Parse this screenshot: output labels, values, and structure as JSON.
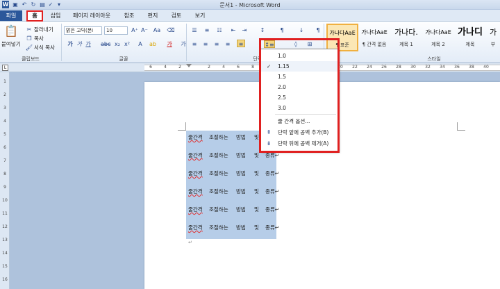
{
  "window": {
    "title": "문서1 - Microsoft Word"
  },
  "qat": {
    "icons": [
      "word-icon",
      "save-icon",
      "undo-icon",
      "redo-icon",
      "print-preview-icon",
      "spelling-icon",
      "customize-icon"
    ]
  },
  "tabs": [
    "파일",
    "홈",
    "삽입",
    "페이지 레이아웃",
    "참조",
    "편지",
    "검토",
    "보기"
  ],
  "ribbon": {
    "clipboard": {
      "paste": "붙여넣기",
      "cut": "잘라내기",
      "copy": "복사",
      "format_painter": "서식 복사",
      "label": "클립보드"
    },
    "font": {
      "name": "맑은 고딕(본ⅰ",
      "size": "10",
      "label": "글꼴"
    },
    "paragraph": {
      "label": "단락"
    },
    "styles": {
      "label": "스타일",
      "items": [
        {
          "preview": "가나다AaE",
          "name": "¶ 표준"
        },
        {
          "preview": "가나다AaE",
          "name": "¶ 간격 없음"
        },
        {
          "preview": "가나다.",
          "name": "제목 1"
        },
        {
          "preview": "가나다AaE",
          "name": "제목 2"
        },
        {
          "preview": "가나디",
          "name": "제목"
        },
        {
          "preview": "가",
          "name": "부"
        }
      ]
    }
  },
  "ruler": {
    "h_ticks": [
      "6",
      "4",
      "2",
      "",
      "2",
      "4",
      "6",
      "8",
      "10",
      "12",
      "14",
      "16",
      "18",
      "20",
      "22",
      "24",
      "26",
      "28",
      "30",
      "32",
      "34",
      "36",
      "38",
      "40"
    ],
    "v_ticks": [
      "1",
      "2",
      "3",
      "4",
      "5",
      "6",
      "7",
      "8",
      "9",
      "10",
      "11",
      "12",
      "13",
      "14",
      "15",
      "16"
    ]
  },
  "document": {
    "lines": [
      {
        "a": "줄간격",
        "b": "조절하는",
        "c": "방법",
        "d": "및",
        "e": "종류↵"
      },
      {
        "a": "줄간격",
        "b": "조절하는",
        "c": "방법",
        "d": "및",
        "e": "종류↵"
      },
      {
        "a": "줄간격",
        "b": "조절하는",
        "c": "방법",
        "d": "및",
        "e": "종류↵"
      },
      {
        "a": "줄간격",
        "b": "조절하는",
        "c": "방법",
        "d": "및",
        "e": "종류↵"
      },
      {
        "a": "줄간격",
        "b": "조절하는",
        "c": "방법",
        "d": "및",
        "e": "종류↵"
      },
      {
        "a": "줄간격",
        "b": "조절하는",
        "c": "방법",
        "d": "및",
        "e": "종류↵"
      }
    ],
    "end_mark": "↵"
  },
  "line_spacing_menu": {
    "options": [
      "1.0",
      "1.15",
      "1.5",
      "2.0",
      "2.5",
      "3.0"
    ],
    "selected": "1.15",
    "line_spacing_options": "줄 간격 옵션...",
    "add_space_before": "단락 앞에 공백 추가(B)",
    "remove_space_after": "단락 뒤에 공백 제거(A)"
  },
  "colors": {
    "accent": "#2b579a",
    "highlight_box": "#e02020",
    "selection": "#b6cde8",
    "doc_bg": "#aec2dc"
  }
}
